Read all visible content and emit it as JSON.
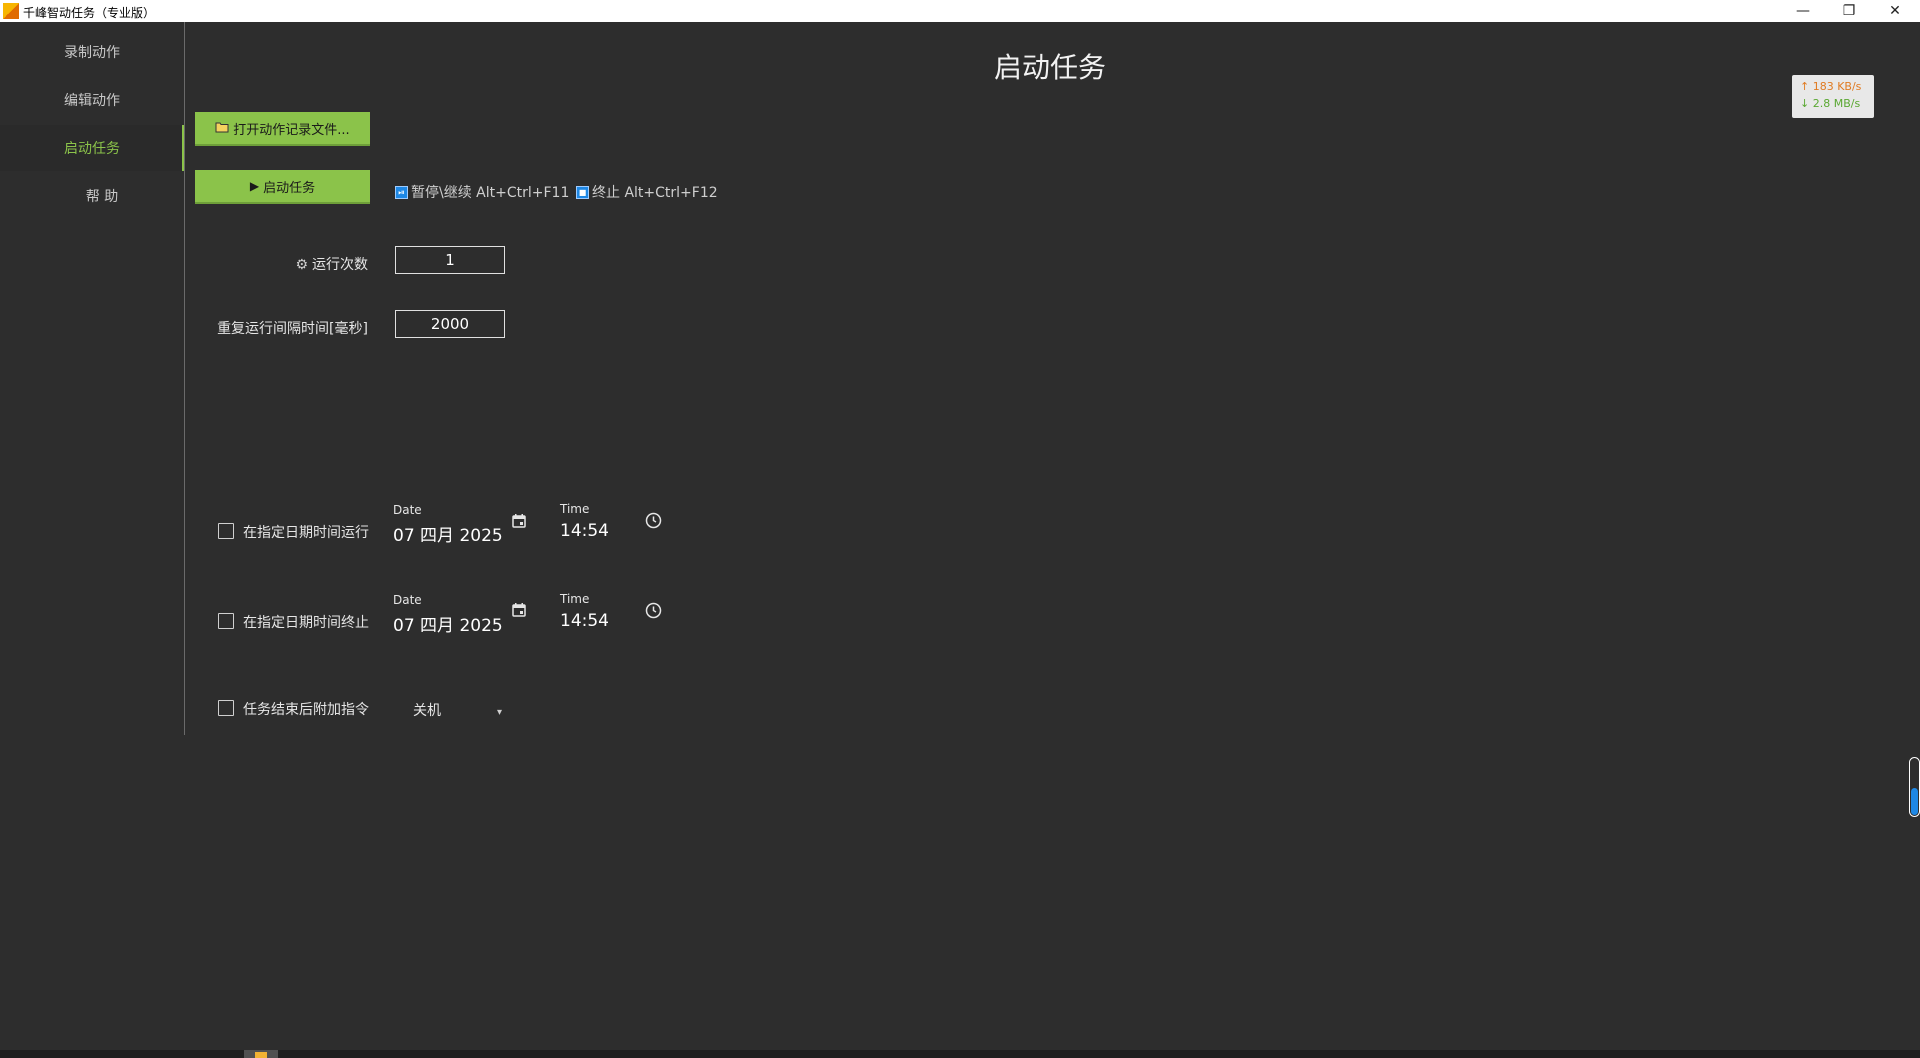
{
  "window": {
    "title": "千峰智动任务（专业版）",
    "controls": {
      "minimize": "—",
      "restore": "❐",
      "close": "✕"
    }
  },
  "sidebar": {
    "items": [
      {
        "label": "录制动作",
        "active": false
      },
      {
        "label": "编辑动作",
        "active": false
      },
      {
        "label": "启动任务",
        "active": true
      },
      {
        "label": "帮 助",
        "active": false
      }
    ],
    "active_color": "#8bc34a"
  },
  "main": {
    "heading": "启动任务",
    "open_file_button": "打开动作记录文件...",
    "start_button": "启动任务",
    "hotkeys": {
      "pause_resume": "暂停\\继续 Alt+Ctrl+F11",
      "stop": "终止 Alt+Ctrl+F12"
    },
    "run_count": {
      "label": "运行次数",
      "value": "1"
    },
    "repeat_interval": {
      "label": "重复运行间隔时间[毫秒]",
      "value": "2000"
    },
    "start_at": {
      "checked": false,
      "label": "在指定日期时间运行",
      "date_caption": "Date",
      "date_value": "07 四月 2025",
      "time_caption": "Time",
      "time_value": "14:54"
    },
    "stop_at": {
      "checked": false,
      "label": "在指定日期时间终止",
      "date_caption": "Date",
      "date_value": "07 四月 2025",
      "time_caption": "Time",
      "time_value": "14:54"
    },
    "post_command": {
      "checked": false,
      "label": "任务结束后附加指令",
      "selected": "关机"
    },
    "accent_color": "#8bc34a"
  },
  "network_monitor": {
    "upload": "↑ 183 KB/s",
    "download": "↓ 2.8 MB/s"
  }
}
